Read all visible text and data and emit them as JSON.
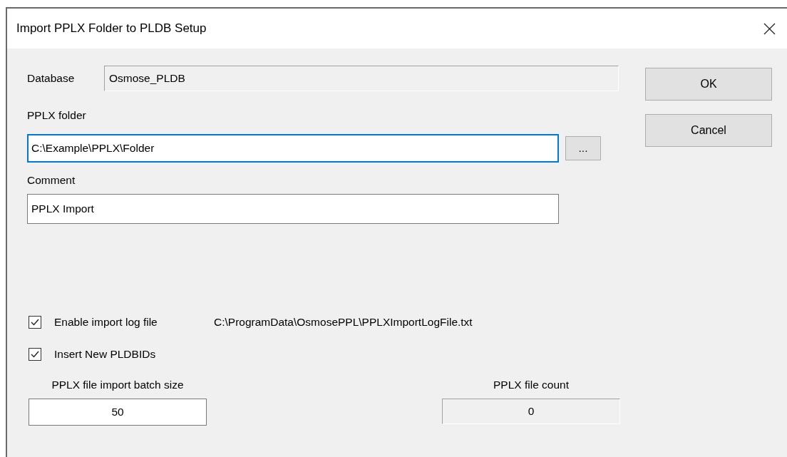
{
  "window": {
    "title": "Import PPLX Folder to PLDB Setup"
  },
  "database": {
    "label": "Database",
    "value": "Osmose_PLDB"
  },
  "pplx_folder": {
    "label": "PPLX folder",
    "value": "C:\\Example\\PPLX\\Folder",
    "focused": true
  },
  "browse_button": "...",
  "comment": {
    "label": "Comment",
    "value": "PPLX Import",
    "focused": false
  },
  "options": [
    {
      "label": "Enable import log file",
      "checked": true,
      "path": "C:\\ProgramData\\OsmosePPL\\PPLXImportLogFile.txt"
    },
    {
      "label": "Insert New PLDBIDs",
      "checked": true
    }
  ],
  "batch_size": {
    "label": "PPLX file import batch size",
    "value": "50"
  },
  "file_count": {
    "label": "PPLX file count",
    "value": "0"
  },
  "buttons": [
    "OK",
    "Cancel"
  ]
}
